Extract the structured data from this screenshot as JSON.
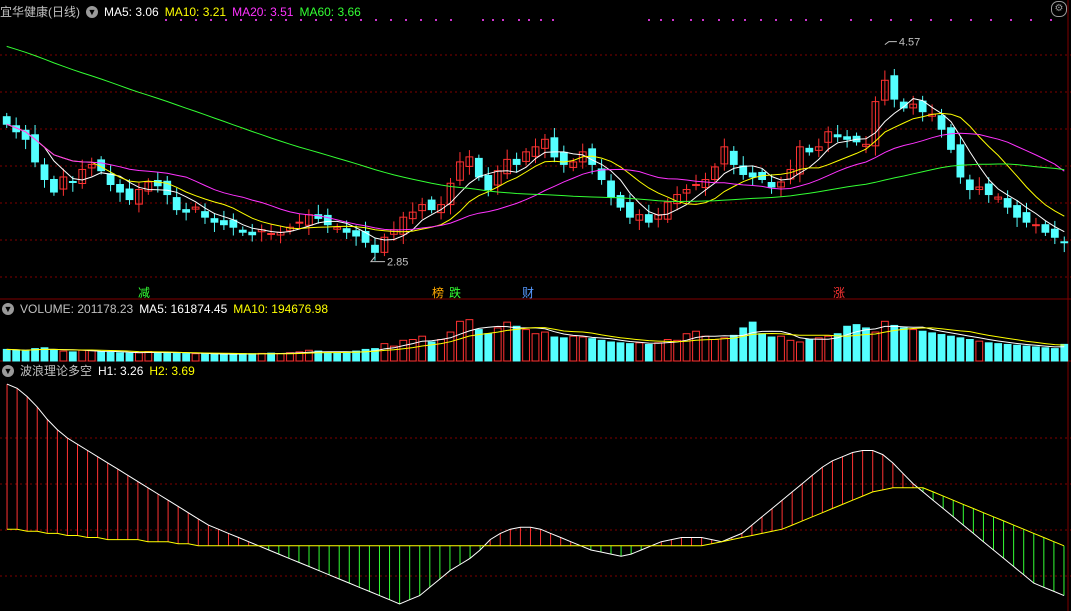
{
  "colors": {
    "up": "#ff3232",
    "down": "#54ffff",
    "ma5": "#ffffff",
    "ma10": "#ffff00",
    "ma20": "#ff33ff",
    "ma60": "#33ff33",
    "grid": "#800000"
  },
  "header": {
    "stock": "宜华健康(日线)",
    "ma5": "MA5: 3.06",
    "ma10": "MA10: 3.21",
    "ma20": "MA20: 3.51",
    "ma60": "MA60: 3.66"
  },
  "volume_header": {
    "vol": "VOLUME: 201178.23",
    "ma5": "MA5: 161874.45",
    "ma10": "MA10: 194676.98"
  },
  "wave_header": {
    "name": "波浪理论多空",
    "h1": "H1: 3.26",
    "h2": "H2: 3.69"
  },
  "price_labels": {
    "high": "4.57",
    "low": "2.85"
  },
  "markers": [
    {
      "text": "减",
      "color": "#33ff33"
    },
    {
      "text": "榜",
      "color": "#ffaa00"
    },
    {
      "text": "跌",
      "color": "#33ff33"
    },
    {
      "text": "财",
      "color": "#5599ff"
    },
    {
      "text": "涨",
      "color": "#ff3232"
    }
  ],
  "icons": [
    "dropdown-icon",
    "settings-icon"
  ],
  "chart_data": [
    {
      "type": "candlestick",
      "title": "宜华健康(日线)",
      "ylim": [
        2.6,
        4.75
      ],
      "high_point": 4.57,
      "low_point": 2.85,
      "close_series": [
        3.92,
        3.86,
        3.8,
        3.62,
        3.48,
        3.38,
        3.5,
        3.46,
        3.56,
        3.6,
        3.55,
        3.44,
        3.38,
        3.32,
        3.4,
        3.46,
        3.43,
        3.36,
        3.24,
        3.22,
        3.26,
        3.18,
        3.14,
        3.12,
        3.1,
        3.06,
        3.04,
        3.08,
        3.05,
        3.06,
        3.1,
        3.14,
        3.2,
        3.17,
        3.12,
        3.1,
        3.06,
        3.03,
        2.98,
        2.9,
        3.02,
        3.08,
        3.18,
        3.22,
        3.28,
        3.24,
        3.28,
        3.45,
        3.62,
        3.66,
        3.5,
        3.4,
        3.55,
        3.64,
        3.6,
        3.7,
        3.74,
        3.8,
        3.66,
        3.6,
        3.62,
        3.7,
        3.6,
        3.48,
        3.34,
        3.26,
        3.18,
        3.2,
        3.14,
        3.2,
        3.3,
        3.36,
        3.4,
        3.44,
        3.48,
        3.58,
        3.74,
        3.6,
        3.52,
        3.5,
        3.48,
        3.42,
        3.46,
        3.56,
        3.74,
        3.7,
        3.74,
        3.86,
        3.82,
        3.8,
        3.78,
        3.76,
        4.1,
        4.27,
        4.12,
        4.05,
        4.08,
        4.02,
        4.0,
        3.88,
        3.72,
        3.5,
        3.4,
        3.42,
        3.36,
        3.34,
        3.26,
        3.18,
        3.14,
        3.12,
        3.06,
        3.02,
        2.98
      ]
    },
    {
      "type": "bar",
      "title": "VOLUME",
      "value": 201178.23,
      "ma5": 161874.45,
      "ma10": 194676.98,
      "values": [
        140,
        130,
        120,
        150,
        160,
        140,
        120,
        110,
        130,
        125,
        110,
        105,
        100,
        95,
        100,
        115,
        105,
        100,
        95,
        90,
        88,
        85,
        82,
        80,
        85,
        90,
        88,
        92,
        95,
        90,
        100,
        110,
        130,
        120,
        100,
        95,
        110,
        120,
        140,
        150,
        210,
        180,
        250,
        260,
        300,
        230,
        260,
        350,
        480,
        500,
        380,
        330,
        400,
        470,
        420,
        380,
        330,
        350,
        290,
        280,
        300,
        290,
        270,
        250,
        230,
        220,
        210,
        220,
        200,
        220,
        260,
        250,
        330,
        360,
        300,
        260,
        280,
        310,
        400,
        470,
        330,
        290,
        300,
        250,
        230,
        260,
        280,
        300,
        330,
        420,
        440,
        400,
        350,
        480,
        430,
        400,
        380,
        360,
        340,
        320,
        300,
        280,
        260,
        240,
        220,
        210,
        200,
        190,
        180,
        170,
        160,
        150,
        201
      ]
    },
    {
      "type": "area",
      "title": "波浪理论多空",
      "h1": 3.26,
      "h2": 3.69,
      "values": [
        3.8,
        3.78,
        3.74,
        3.69,
        3.63,
        3.58,
        3.54,
        3.51,
        3.48,
        3.45,
        3.42,
        3.39,
        3.36,
        3.33,
        3.3,
        3.27,
        3.24,
        3.21,
        3.18,
        3.15,
        3.12,
        3.1,
        3.08,
        3.06,
        3.04,
        3.02,
        3.0,
        2.98,
        2.96,
        2.94,
        2.92,
        2.9,
        2.88,
        2.86,
        2.84,
        2.82,
        2.8,
        2.78,
        2.76,
        2.74,
        2.76,
        2.78,
        2.82,
        2.86,
        2.9,
        2.93,
        2.96,
        3.0,
        3.05,
        3.08,
        3.1,
        3.11,
        3.11,
        3.1,
        3.08,
        3.06,
        3.04,
        3.02,
        3.0,
        2.99,
        2.98,
        2.97,
        2.98,
        3.0,
        3.02,
        3.04,
        3.05,
        3.06,
        3.06,
        3.06,
        3.05,
        3.04,
        3.06,
        3.08,
        3.12,
        3.16,
        3.2,
        3.24,
        3.28,
        3.32,
        3.36,
        3.4,
        3.43,
        3.45,
        3.47,
        3.48,
        3.48,
        3.46,
        3.42,
        3.37,
        3.32,
        3.28,
        3.24,
        3.2,
        3.16,
        3.12,
        3.08,
        3.04,
        3.0,
        2.96,
        2.92,
        2.88,
        2.84,
        2.82,
        2.8,
        2.78
      ],
      "signal": [
        3.1,
        3.1,
        3.09,
        3.09,
        3.08,
        3.08,
        3.07,
        3.07,
        3.06,
        3.06,
        3.05,
        3.05,
        3.05,
        3.05,
        3.04,
        3.04,
        3.04,
        3.03,
        3.03,
        3.02,
        3.02,
        3.02,
        3.02,
        3.02,
        3.02,
        3.02,
        3.02,
        3.02,
        3.02,
        3.02,
        3.02,
        3.02,
        3.02,
        3.02,
        3.02,
        3.02,
        3.02,
        3.02,
        3.02,
        3.02,
        3.02,
        3.02,
        3.02,
        3.02,
        3.02,
        3.02,
        3.02,
        3.02,
        3.02,
        3.02,
        3.02,
        3.02,
        3.02,
        3.02,
        3.02,
        3.02,
        3.02,
        3.02,
        3.02,
        3.02,
        3.02,
        3.02,
        3.02,
        3.02,
        3.02,
        3.02,
        3.02,
        3.02,
        3.02,
        3.02,
        3.03,
        3.04,
        3.05,
        3.06,
        3.07,
        3.08,
        3.09,
        3.1,
        3.12,
        3.14,
        3.16,
        3.18,
        3.2,
        3.22,
        3.24,
        3.26,
        3.28,
        3.29,
        3.3,
        3.3,
        3.3,
        3.3,
        3.28,
        3.26,
        3.24,
        3.22,
        3.2,
        3.18,
        3.16,
        3.14,
        3.12,
        3.1,
        3.08,
        3.06,
        3.04,
        3.02
      ]
    }
  ]
}
